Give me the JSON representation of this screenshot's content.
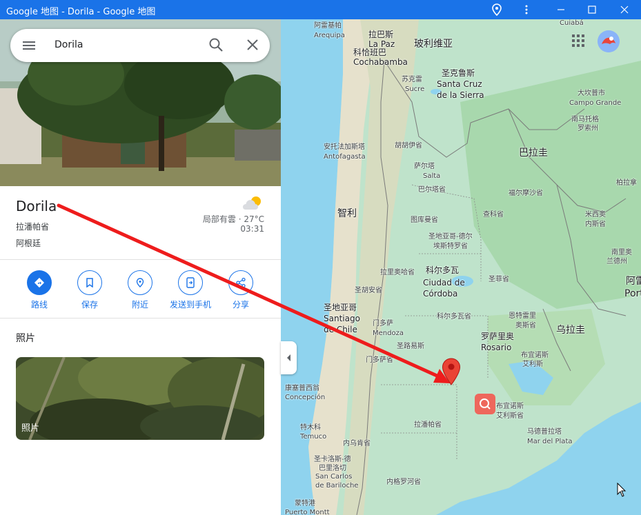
{
  "window": {
    "title": "Google 地图 - Dorila - Google 地图",
    "buttons": [
      "location-icon",
      "more-vert-icon",
      "minimize-icon",
      "maximize-icon",
      "close-icon"
    ]
  },
  "search": {
    "value": "Dorila"
  },
  "place": {
    "name": "Dorila",
    "region": "拉潘帕省",
    "country": "阿根廷"
  },
  "weather": {
    "condition": "局部有雲 · 27°C",
    "time": "03:31"
  },
  "actions": [
    {
      "label": "路线",
      "icon": "directions-icon"
    },
    {
      "label": "保存",
      "icon": "bookmark-icon"
    },
    {
      "label": "附近",
      "icon": "nearby-icon"
    },
    {
      "label": "发送到手机",
      "icon": "send-to-phone-icon"
    },
    {
      "label": "分享",
      "icon": "share-icon"
    }
  ],
  "photos": {
    "heading": "照片",
    "card_label": "照片"
  },
  "map_labels": [
    {
      "text": "阿雷基帕",
      "cls": ""
    },
    {
      "text": "Arequipa",
      "cls": ""
    },
    {
      "text": "拉巴斯",
      "cls": "city"
    },
    {
      "text": "La Paz",
      "cls": "city"
    },
    {
      "text": "Cuiabá",
      "cls": ""
    },
    {
      "text": "科恰班巴",
      "cls": "city"
    },
    {
      "text": "Cochabamba",
      "cls": "city"
    },
    {
      "text": "玻利维亚",
      "cls": "big"
    },
    {
      "text": "苏克雷",
      "cls": ""
    },
    {
      "text": "Sucre",
      "cls": ""
    },
    {
      "text": "圣克鲁斯",
      "cls": "city"
    },
    {
      "text": "Santa Cruz",
      "cls": "city"
    },
    {
      "text": "de la Sierra",
      "cls": "city"
    },
    {
      "text": "大坎普市",
      "cls": ""
    },
    {
      "text": "Campo Grande",
      "cls": ""
    },
    {
      "text": "南马托格",
      "cls": ""
    },
    {
      "text": "罗索州",
      "cls": ""
    },
    {
      "text": "安托法加斯塔",
      "cls": ""
    },
    {
      "text": "Antofagasta",
      "cls": ""
    },
    {
      "text": "胡胡伊省",
      "cls": ""
    },
    {
      "text": "巴拉圭",
      "cls": "big"
    },
    {
      "text": "萨尔塔",
      "cls": ""
    },
    {
      "text": "Salta",
      "cls": ""
    },
    {
      "text": "巴尔塔省",
      "cls": ""
    },
    {
      "text": "福尔摩沙省",
      "cls": ""
    },
    {
      "text": "柏拉拿",
      "cls": ""
    },
    {
      "text": "智利",
      "cls": "big"
    },
    {
      "text": "图库曼省",
      "cls": ""
    },
    {
      "text": "查科省",
      "cls": ""
    },
    {
      "text": "米西奥",
      "cls": ""
    },
    {
      "text": "内斯省",
      "cls": ""
    },
    {
      "text": "圣地亚哥-德尔",
      "cls": ""
    },
    {
      "text": "埃斯特罗省",
      "cls": ""
    },
    {
      "text": "南里奥",
      "cls": ""
    },
    {
      "text": "兰德州",
      "cls": ""
    },
    {
      "text": "拉里奥哈省",
      "cls": ""
    },
    {
      "text": "科尔多瓦",
      "cls": "city"
    },
    {
      "text": "Ciudad de",
      "cls": "city"
    },
    {
      "text": "Córdoba",
      "cls": "city"
    },
    {
      "text": "圣菲省",
      "cls": ""
    },
    {
      "text": "阿雷",
      "cls": "big"
    },
    {
      "text": "Porto",
      "cls": "big"
    },
    {
      "text": "圣胡安省",
      "cls": ""
    },
    {
      "text": "圣地亚哥",
      "cls": "city"
    },
    {
      "text": "Santiago",
      "cls": "city"
    },
    {
      "text": "de Chile",
      "cls": "city"
    },
    {
      "text": "门多萨",
      "cls": ""
    },
    {
      "text": "Mendoza",
      "cls": ""
    },
    {
      "text": "科尔多瓦省",
      "cls": ""
    },
    {
      "text": "恩特雷里",
      "cls": ""
    },
    {
      "text": "奥斯省",
      "cls": ""
    },
    {
      "text": "乌拉圭",
      "cls": "big"
    },
    {
      "text": "罗萨里奥",
      "cls": "city"
    },
    {
      "text": "Rosario",
      "cls": "city"
    },
    {
      "text": "圣路易斯",
      "cls": ""
    },
    {
      "text": "门多萨省",
      "cls": ""
    },
    {
      "text": "布宜诺斯",
      "cls": ""
    },
    {
      "text": "艾利斯",
      "cls": ""
    },
    {
      "text": "康塞普西翁",
      "cls": ""
    },
    {
      "text": "Concepción",
      "cls": ""
    },
    {
      "text": "布宜诺斯",
      "cls": ""
    },
    {
      "text": "艾利斯省",
      "cls": ""
    },
    {
      "text": "特木科",
      "cls": ""
    },
    {
      "text": "Temuco",
      "cls": ""
    },
    {
      "text": "拉潘帕省",
      "cls": ""
    },
    {
      "text": "马德普拉塔",
      "cls": ""
    },
    {
      "text": "Mar del Plata",
      "cls": ""
    },
    {
      "text": "内乌肯省",
      "cls": ""
    },
    {
      "text": "圣卡洛斯-德",
      "cls": ""
    },
    {
      "text": "巴里洛切",
      "cls": ""
    },
    {
      "text": "San Carlos",
      "cls": ""
    },
    {
      "text": "de Bariloche",
      "cls": ""
    },
    {
      "text": "内格罗河省",
      "cls": ""
    },
    {
      "text": "蒙特港",
      "cls": ""
    },
    {
      "text": "Puerto Montt",
      "cls": ""
    }
  ],
  "colors": {
    "accent": "#1a73e8",
    "annotation_arrow": "#ee1c1c",
    "pin": "#ea4335"
  }
}
